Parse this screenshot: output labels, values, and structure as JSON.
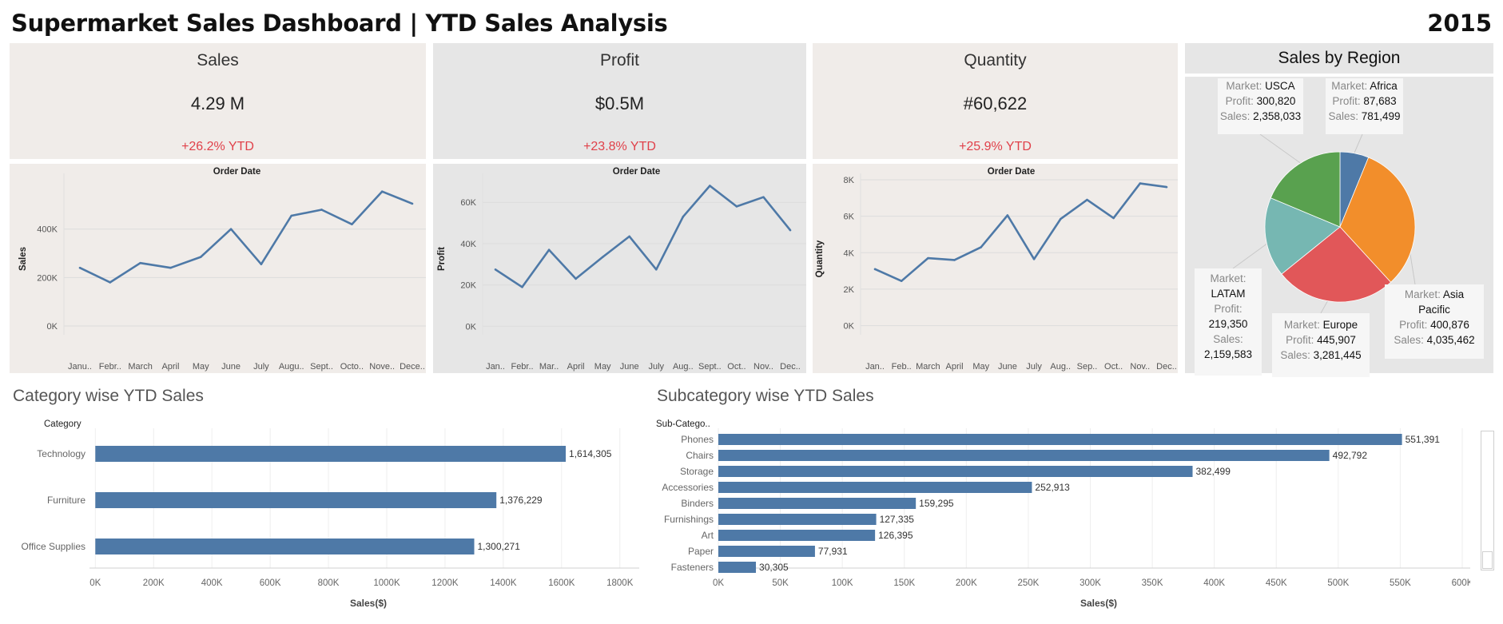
{
  "header": {
    "title": "Supermarket Sales Dashboard | YTD Sales Analysis",
    "year": "2015"
  },
  "kpis": [
    {
      "label": "Sales",
      "value": "4.29 M",
      "ytd": "+26.2% YTD"
    },
    {
      "label": "Profit",
      "value": "$0.5M",
      "ytd": "+23.8% YTD"
    },
    {
      "label": "Quantity",
      "value": "#60,622",
      "ytd": "+25.9% YTD"
    }
  ],
  "region": {
    "title": "Sales by Region",
    "tooltips": [
      {
        "key": "usca",
        "l1": "Market: ",
        "m": "USCA",
        "l2": "Profit: ",
        "p": "300,820",
        "l3": "Sales: ",
        "s": "2,358,033"
      },
      {
        "key": "africa",
        "l1": "Market: ",
        "m": "Africa",
        "l2": "Profit: ",
        "p": "87,683",
        "l3": "Sales: ",
        "s": "781,499"
      },
      {
        "key": "latam",
        "l1": "Market: ",
        "m": "LATAM",
        "l2": "Profit: ",
        "p": "219,350",
        "l3": "Sales: ",
        "s": "2,159,583"
      },
      {
        "key": "europe",
        "l1": "Market: ",
        "m": "Europe",
        "l2": "Profit: ",
        "p": "445,907",
        "l3": "Sales: ",
        "s": "3,281,445"
      },
      {
        "key": "apac",
        "l1": "Market: ",
        "m": "Asia Pacific",
        "l2": "Profit: ",
        "p": "400,876",
        "l3": "Sales: ",
        "s": "4,035,462"
      }
    ]
  },
  "sections": {
    "category_title": "Category wise YTD Sales",
    "subcategory_title": "Subcategory wise YTD Sales"
  },
  "chart_data": [
    {
      "type": "line",
      "title": "Order Date",
      "ylabel": "Sales",
      "x": [
        "Janu..",
        "Febr..",
        "March",
        "April",
        "May",
        "June",
        "July",
        "Augu..",
        "Sept..",
        "Octo..",
        "Nove..",
        "Dece.."
      ],
      "values": [
        240000,
        180000,
        260000,
        240000,
        285000,
        400000,
        255000,
        455000,
        480000,
        420000,
        555000,
        505000
      ],
      "yticks": [
        0,
        200000,
        400000
      ],
      "ytick_labels": [
        "0K",
        "200K",
        "400K"
      ],
      "ylim": [
        -10000,
        630000
      ],
      "color": "#4e79a7"
    },
    {
      "type": "line",
      "title": "Order Date",
      "ylabel": "Profit",
      "x": [
        "Jan..",
        "Febr..",
        "Mar..",
        "April",
        "May",
        "June",
        "July",
        "Aug..",
        "Sept..",
        "Oct..",
        "Nov..",
        "Dec.."
      ],
      "values": [
        27500,
        19000,
        37000,
        23000,
        33500,
        43500,
        27500,
        53000,
        68000,
        58000,
        62500,
        46500
      ],
      "yticks": [
        0,
        20000,
        40000,
        60000
      ],
      "ytick_labels": [
        "0K",
        "20K",
        "40K",
        "60K"
      ],
      "ylim": [
        -1000,
        74000
      ],
      "color": "#4e79a7"
    },
    {
      "type": "line",
      "title": "Order Date",
      "ylabel": "Quantity",
      "x": [
        "Jan..",
        "Feb..",
        "March",
        "April",
        "May",
        "June",
        "July",
        "Aug..",
        "Sep..",
        "Oct..",
        "Nov..",
        "Dec.."
      ],
      "values": [
        3100,
        2450,
        3700,
        3600,
        4300,
        6050,
        3650,
        5850,
        6900,
        5900,
        7800,
        7600
      ],
      "yticks": [
        0,
        2000,
        4000,
        6000,
        8000
      ],
      "ytick_labels": [
        "0K",
        "2K",
        "4K",
        "6K",
        "8K"
      ],
      "ylim": [
        -150,
        8350
      ],
      "color": "#4e79a7"
    },
    {
      "type": "pie",
      "title": "Sales by Region",
      "categories": [
        "Africa",
        "Asia Pacific",
        "Europe",
        "LATAM",
        "USCA"
      ],
      "values": [
        781499,
        4035462,
        3281445,
        2159583,
        2358033
      ],
      "colors": [
        "#4e79a7",
        "#f28e2b",
        "#e15759",
        "#76b7b2",
        "#59a14f"
      ]
    },
    {
      "type": "bar",
      "orientation": "horizontal",
      "title": "Category wise YTD Sales",
      "category_label": "Category",
      "xlabel": "Sales($)",
      "categories": [
        "Technology",
        "Furniture",
        "Office Supplies"
      ],
      "values": [
        1614305,
        1376229,
        1300271
      ],
      "value_labels": [
        "1,614,305",
        "1,376,229",
        "1,300,271"
      ],
      "xticks": [
        0,
        200000,
        400000,
        600000,
        800000,
        1000000,
        1200000,
        1400000,
        1600000,
        1800000
      ],
      "xtick_labels": [
        "0K",
        "200K",
        "400K",
        "600K",
        "800K",
        "1000K",
        "1200K",
        "1400K",
        "1600K",
        "1800K"
      ],
      "xlim": [
        -20000,
        1850000
      ],
      "color": "#4e79a7"
    },
    {
      "type": "bar",
      "orientation": "horizontal",
      "title": "Subcategory wise YTD Sales",
      "category_label": "Sub-Catego..",
      "xlabel": "Sales($)",
      "categories": [
        "Phones",
        "Chairs",
        "Storage",
        "Accessories",
        "Binders",
        "Furnishings",
        "Art",
        "Paper",
        "Fasteners"
      ],
      "values": [
        551391,
        492792,
        382499,
        252913,
        159295,
        127335,
        126395,
        77931,
        30305
      ],
      "value_labels": [
        "551,391",
        "492,792",
        "382,499",
        "252,913",
        "159,295",
        "127,335",
        "126,395",
        "77,931",
        "30,305"
      ],
      "xticks": [
        0,
        50000,
        100000,
        150000,
        200000,
        250000,
        300000,
        350000,
        400000,
        450000,
        500000,
        550000,
        600000
      ],
      "xtick_labels": [
        "0K",
        "50K",
        "100K",
        "150K",
        "200K",
        "250K",
        "300K",
        "350K",
        "400K",
        "450K",
        "500K",
        "550K",
        "600K"
      ],
      "xlim": [
        0,
        600000
      ],
      "color": "#4e79a7"
    }
  ]
}
